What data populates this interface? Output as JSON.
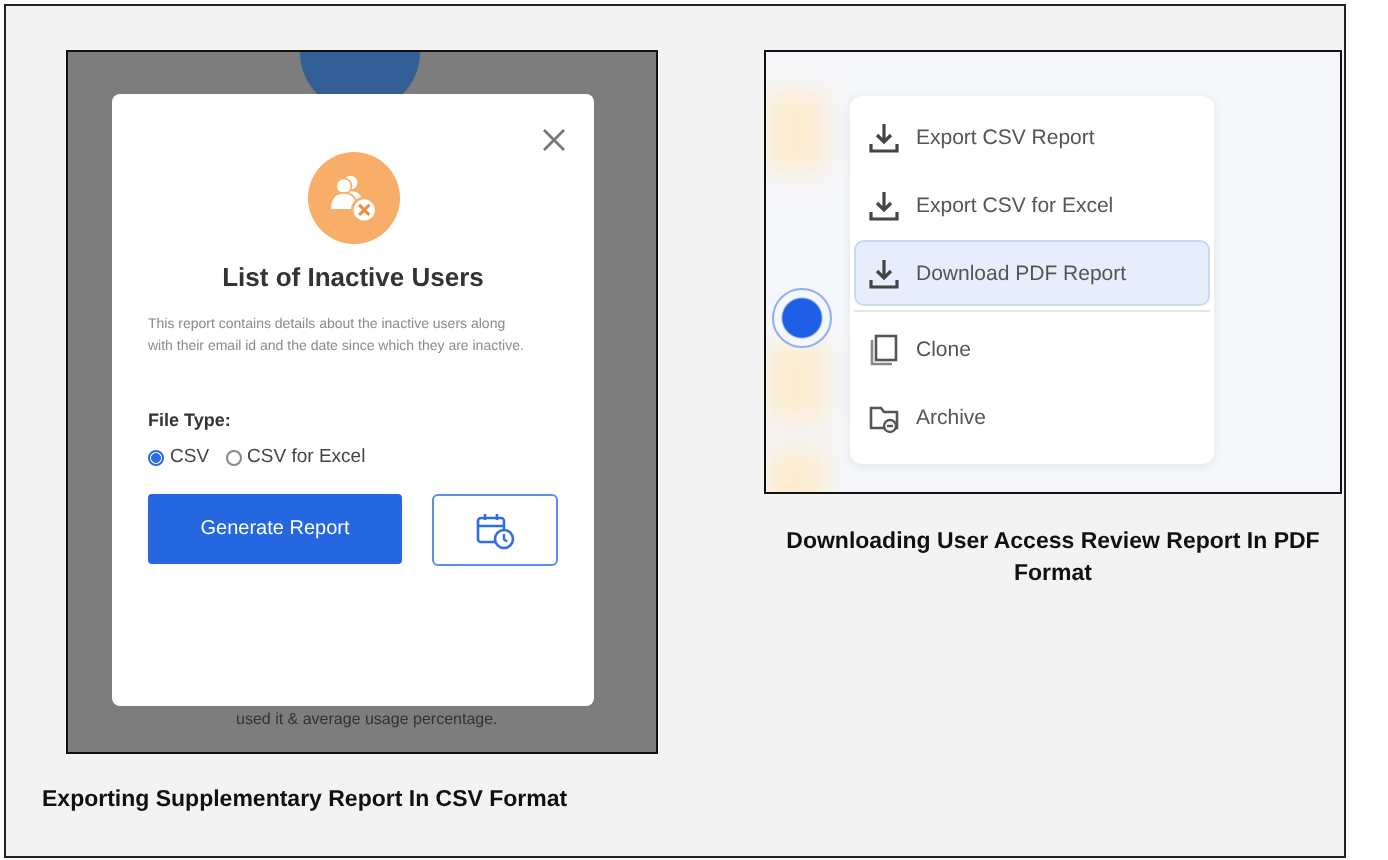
{
  "left_panel": {
    "backdrop_text": "used it & average usage percentage.",
    "dialog": {
      "title": "List of Inactive Users",
      "description": "This report contains details about the inactive users along with their email id and the date since which they are inactive.",
      "file_type_label": "File Type:",
      "options": [
        {
          "label": "CSV",
          "selected": true
        },
        {
          "label": "CSV for Excel",
          "selected": false
        }
      ],
      "primary_button": "Generate Report"
    },
    "caption": "Exporting Supplementary Report In CSV Format"
  },
  "right_panel": {
    "menu": {
      "items": [
        {
          "kind": "download",
          "label": "Export CSV Report",
          "selected": false
        },
        {
          "kind": "download",
          "label": "Export CSV for Excel",
          "selected": false
        },
        {
          "kind": "download",
          "label": "Download PDF Report",
          "selected": true
        },
        {
          "kind": "clone",
          "label": "Clone",
          "selected": false
        },
        {
          "kind": "archive",
          "label": "Archive",
          "selected": false
        }
      ]
    },
    "caption": "Downloading User Access Review Report In PDF Format"
  }
}
